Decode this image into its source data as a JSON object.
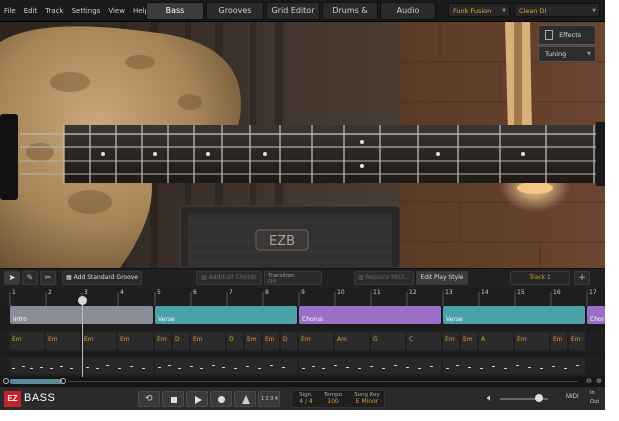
{
  "menu": [
    "File",
    "Edit",
    "Track",
    "Settings",
    "View",
    "Help"
  ],
  "tabs": [
    {
      "label": "Bass",
      "active": true
    },
    {
      "label": "Grooves",
      "active": false
    },
    {
      "label": "Grid Editor",
      "active": false
    },
    {
      "label": "Drums & Keys",
      "active": false
    },
    {
      "label": "Audio Tracker",
      "active": false
    }
  ],
  "presets": {
    "style": "Funk Fusion",
    "tone": "Clean DI"
  },
  "side_panel": {
    "effects": "Effects",
    "tuning": "Tuning"
  },
  "amp_logo": "EZB",
  "toolbar": {
    "add_groove": "Add Standard Groove",
    "add_edit_chords": "Add/Edit Chords",
    "transition_label": "Transition",
    "transition_value": "Off",
    "replace_midi": "Replace MIDI...",
    "edit_play_style": "Edit Play Style",
    "track_name": "Track 1",
    "add_track": "+"
  },
  "ruler_bars": [
    "1",
    "2",
    "3",
    "4",
    "5",
    "6",
    "7",
    "8",
    "9",
    "10",
    "11",
    "12",
    "13",
    "14",
    "15",
    "16",
    "17"
  ],
  "sections": [
    {
      "label": "Intro",
      "color": "#8a8d96"
    },
    {
      "label": "Verse",
      "color": "#4aa2a8"
    },
    {
      "label": "Chorus",
      "color": "#9a6fc8"
    },
    {
      "label": "Verse",
      "color": "#4aa2a8"
    },
    {
      "label": "Chor",
      "color": "#9a6fc8"
    }
  ],
  "chords": [
    "Em",
    "Em",
    "Em",
    "Em",
    "Em",
    "D",
    "Em",
    "D",
    "Em",
    "Em",
    "D",
    "Em",
    "Am",
    "G",
    "C",
    "Em",
    "Em",
    "A",
    "Em",
    "Em",
    "Em"
  ],
  "transport": {
    "logo_ez": "EZ",
    "logo_bass": "BASS",
    "sign_label": "Sign.",
    "sign_value": "4 / 4",
    "tempo_label": "Tempo",
    "tempo_value": "100",
    "key_label": "Song Key",
    "key_value": "E Minor",
    "count_in": "1 2 3 4",
    "midi_label": "MIDI",
    "in_label": "In",
    "out_label": "Out"
  },
  "colors": {
    "accent": "#e09a38",
    "logo_red": "#c8202a"
  }
}
